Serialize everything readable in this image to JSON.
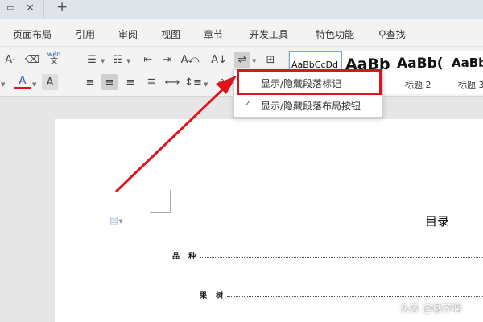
{
  "window": {
    "new_tab": "+",
    "close": "✕"
  },
  "menu": {
    "items": [
      "页面布局",
      "引用",
      "审阅",
      "视图",
      "章节",
      "开发工具",
      "特色功能"
    ],
    "search_label": "查找"
  },
  "ribbon": {
    "pinyin_label": "wén",
    "styles": [
      {
        "sample": "AaBbCcDd",
        "name": ""
      },
      {
        "sample": "AaBb",
        "name": ""
      },
      {
        "sample": "AaBb(",
        "name": "标题 2"
      },
      {
        "sample": "AaBb",
        "name": "标题 3"
      }
    ]
  },
  "dropdown": {
    "items": [
      {
        "label": "显示/隐藏段落标记",
        "checked": false
      },
      {
        "label": "显示/隐藏段落布局按钮",
        "checked": true
      }
    ]
  },
  "annotation": {
    "highlight_color": "#e0121b",
    "arrow_color": "#e0121b"
  },
  "document": {
    "toc_title": "目录",
    "entries": [
      "品 种",
      "果 树"
    ]
  },
  "watermark": "头条 @悬齐啊"
}
